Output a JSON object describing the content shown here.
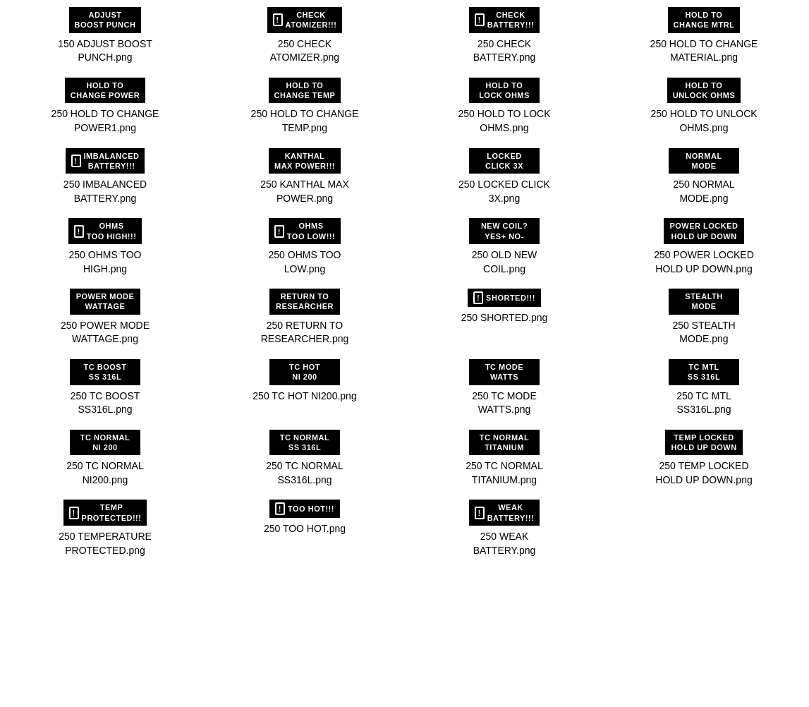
{
  "items": [
    {
      "badge_text": "ADJUST\nBOOST PUNCH",
      "has_icon": false,
      "label": "150 ADJUST BOOST\nPUNCH.png"
    },
    {
      "badge_text": "CHECK\nATOMIZER!!!",
      "has_icon": true,
      "label": "250 CHECK\nATOMIZER.png"
    },
    {
      "badge_text": "CHECK\nBATTERY!!!",
      "has_icon": true,
      "label": "250 CHECK\nBATTERY.png"
    },
    {
      "badge_text": "HOLD TO\nCHANGE MTRL",
      "has_icon": false,
      "label": "250 HOLD TO CHANGE\nMATERIAL.png"
    },
    {
      "badge_text": "HOLD TO\nCHANGE POWER",
      "has_icon": false,
      "label": "250 HOLD TO CHANGE\nPOWER1.png"
    },
    {
      "badge_text": "HOLD TO\nCHANGE TEMP",
      "has_icon": false,
      "label": "250 HOLD TO CHANGE\nTEMP.png"
    },
    {
      "badge_text": "HOLD TO\nLOCK OHMS",
      "has_icon": false,
      "label": "250 HOLD TO LOCK\nOHMS.png"
    },
    {
      "badge_text": "HOLD TO\nUNLOCK OHMS",
      "has_icon": false,
      "label": "250 HOLD TO UNLOCK\nOHMS.png"
    },
    {
      "badge_text": "IMBALANCED\nBATTERY!!!",
      "has_icon": true,
      "label": "250 IMBALANCED\nBATTERY.png"
    },
    {
      "badge_text": "KANTHAL\nMAX POWER!!!",
      "has_icon": false,
      "label": "250 KANTHAL MAX\nPOWER.png"
    },
    {
      "badge_text": "LOCKED\nCLICK 3X",
      "has_icon": false,
      "label": "250 LOCKED CLICK\n3X.png"
    },
    {
      "badge_text": "NORMAL\nMODE",
      "has_icon": false,
      "label": "250 NORMAL\nMODE.png"
    },
    {
      "badge_text": "OHMS\nTOO HIGH!!!",
      "has_icon": true,
      "label": "250 OHMS TOO\nHIGH.png"
    },
    {
      "badge_text": "OHMS\nTOO LOW!!!",
      "has_icon": true,
      "label": "250 OHMS TOO\nLOW.png"
    },
    {
      "badge_text": "NEW COIL?\nYES+ NO-",
      "has_icon": false,
      "label": "250 OLD NEW\nCOIL.png"
    },
    {
      "badge_text": "POWER LOCKED\nHOLD UP DOWN",
      "has_icon": false,
      "label": "250 POWER LOCKED\nHOLD UP DOWN.png"
    },
    {
      "badge_text": "POWER MODE\nWATTAGE",
      "has_icon": false,
      "label": "250 POWER MODE\nWATTAGE.png"
    },
    {
      "badge_text": "RETURN TO\nRESEARCHER",
      "has_icon": false,
      "label": "250 RETURN TO\nRESEARCHER.png"
    },
    {
      "badge_text": "SHORTED!!!",
      "has_icon": true,
      "label": "250 SHORTED.png"
    },
    {
      "badge_text": "STEALTH\nMODE",
      "has_icon": false,
      "label": "250 STEALTH\nMODE.png"
    },
    {
      "badge_text": "TC BOOST\nSS 316L",
      "has_icon": false,
      "label": "250 TC BOOST\nSS316L.png"
    },
    {
      "badge_text": "TC HOT\nNi 200",
      "has_icon": false,
      "label": "250 TC HOT NI200.png"
    },
    {
      "badge_text": "TC MODE\nWATTS",
      "has_icon": false,
      "label": "250 TC MODE\nWATTS.png"
    },
    {
      "badge_text": "TC MTL\nSS 316L",
      "has_icon": false,
      "label": "250 TC MTL\nSS316L.png"
    },
    {
      "badge_text": "TC NORMAL\nNi 200",
      "has_icon": false,
      "label": "250 TC NORMAL\nNI200.png"
    },
    {
      "badge_text": "TC NORMAL\nSS 316L",
      "has_icon": false,
      "label": "250 TC NORMAL\nSS316L.png"
    },
    {
      "badge_text": "TC NORMAL\nTITANIUM",
      "has_icon": false,
      "label": "250 TC NORMAL\nTITANIUM.png"
    },
    {
      "badge_text": "TEMP LOCKED\nHOLD UP DOWN",
      "has_icon": false,
      "label": "250 TEMP LOCKED\nHOLD UP DOWN.png"
    },
    {
      "badge_text": "TEMP\nPROTECTED!!!",
      "has_icon": true,
      "label": "250 TEMPERATURE\nPROTECTED.png"
    },
    {
      "badge_text": "TOO HOT!!!",
      "has_icon": true,
      "label": "250 TOO HOT.png"
    },
    {
      "badge_text": "WEAK\nBATTERY!!!",
      "has_icon": true,
      "label": "250 WEAK\nBATTERY.png"
    },
    {
      "badge_text": "",
      "has_icon": false,
      "label": ""
    }
  ]
}
